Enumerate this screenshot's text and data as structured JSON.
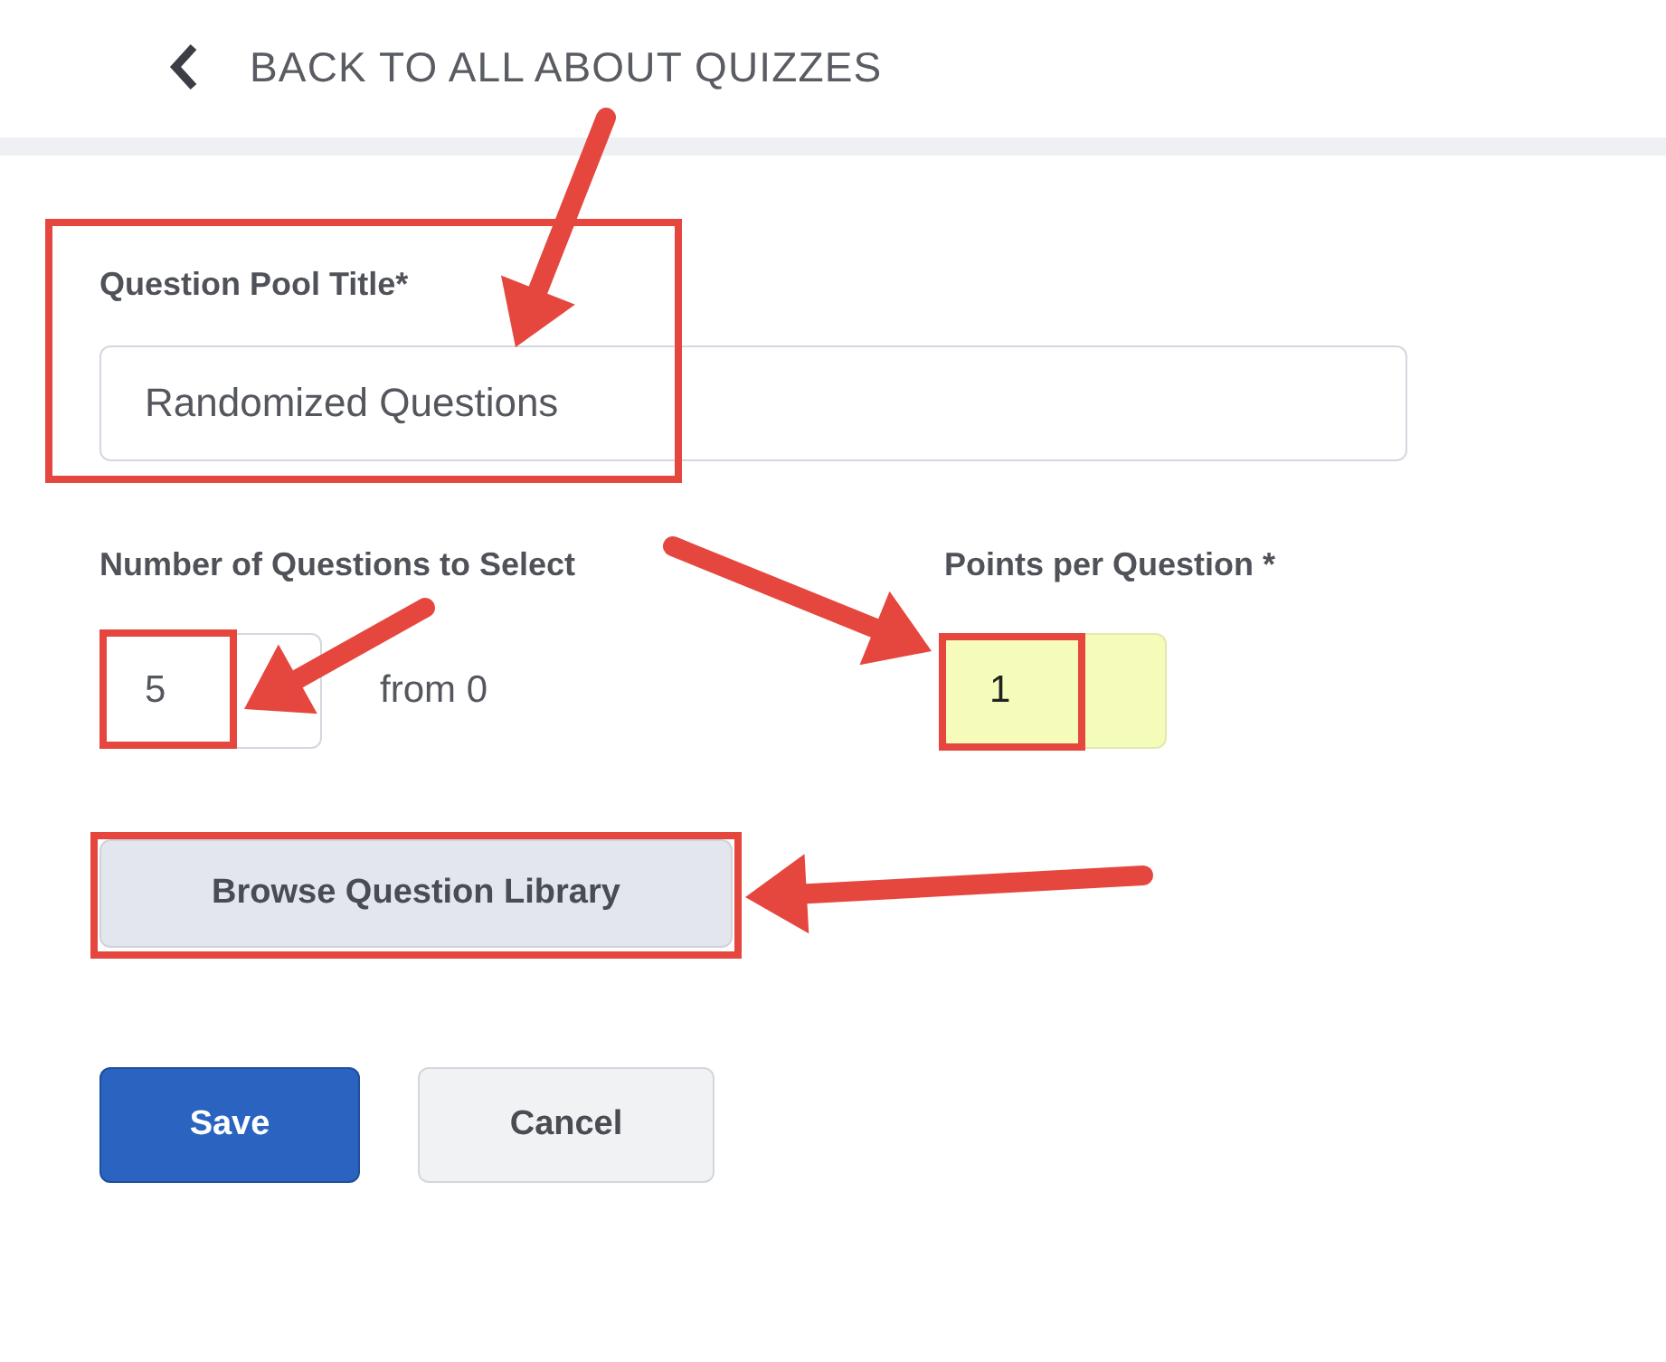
{
  "back_link": {
    "label": "BACK TO ALL ABOUT QUIZZES"
  },
  "title_field": {
    "label": "Question Pool Title*",
    "value": "Randomized Questions"
  },
  "count_field": {
    "label": "Number of Questions to Select",
    "value": "5",
    "suffix": "from 0"
  },
  "points_field": {
    "label": "Points per Question *",
    "value": "1",
    "highlighted": true
  },
  "browse_button": {
    "label": "Browse Question Library"
  },
  "buttons": [
    {
      "label": "Save",
      "kind": "primary"
    },
    {
      "label": "Cancel",
      "kind": "secondary"
    }
  ]
}
